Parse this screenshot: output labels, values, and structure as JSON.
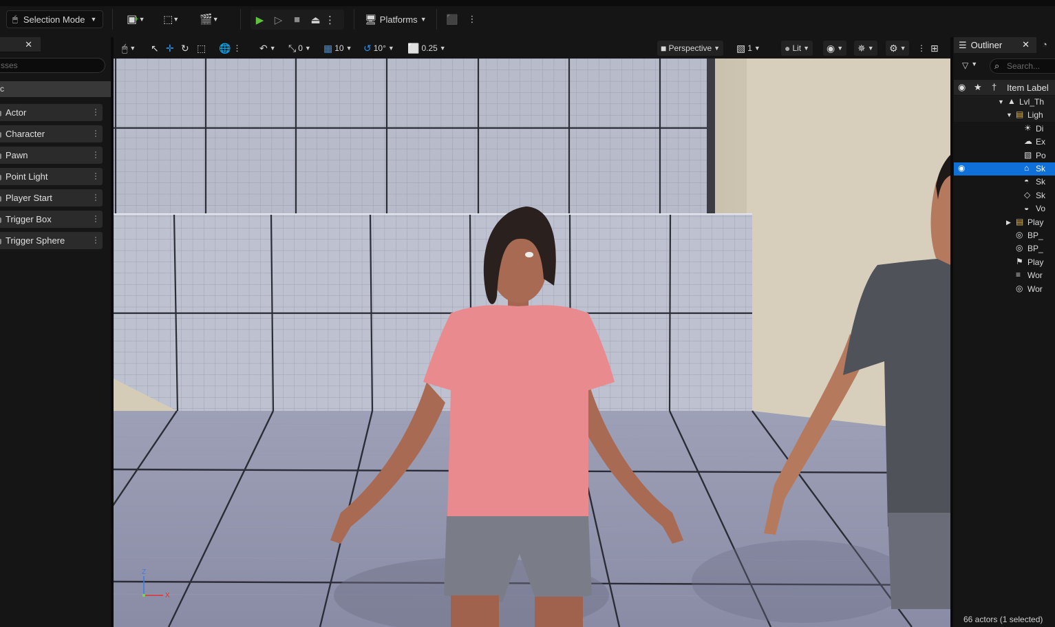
{
  "toolbar": {
    "selection_mode": "Selection Mode",
    "platforms": "Platforms"
  },
  "left_panel": {
    "search_placeholder": "sses",
    "category": "c",
    "items": [
      {
        "label": "Actor"
      },
      {
        "label": "Character"
      },
      {
        "label": "Pawn"
      },
      {
        "label": "Point Light"
      },
      {
        "label": "Player Start"
      },
      {
        "label": "Trigger Box"
      },
      {
        "label": "Trigger Sphere"
      }
    ]
  },
  "viewport_toolbar": {
    "rotation_snap": "0",
    "grid_snap": "10",
    "angle_snap": "10°",
    "scale_snap": "0.25",
    "view_mode": "Perspective",
    "camera_speed": "1",
    "lighting_mode": "Lit"
  },
  "axis": {
    "z": "Z",
    "x": "X"
  },
  "outliner": {
    "tab_title": "Outliner",
    "search_placeholder": "Search...",
    "column_label": "Item Label",
    "rows": [
      {
        "label": "Lvl_Th",
        "indent": 1,
        "icon": "level-icon",
        "expanded": true
      },
      {
        "label": "Ligh",
        "indent": 2,
        "icon": "folder-icon",
        "expanded": true
      },
      {
        "label": "Di",
        "indent": 3,
        "icon": "directional-light-icon"
      },
      {
        "label": "Ex",
        "indent": 3,
        "icon": "exponential-fog-icon"
      },
      {
        "label": "Po",
        "indent": 3,
        "icon": "post-process-icon"
      },
      {
        "label": "Sk",
        "indent": 3,
        "icon": "sky-light-icon",
        "selected": true
      },
      {
        "label": "Sk",
        "indent": 3,
        "icon": "sky-atmosphere-icon"
      },
      {
        "label": "Sk",
        "indent": 3,
        "icon": "sky-sphere-icon"
      },
      {
        "label": "Vo",
        "indent": 3,
        "icon": "volumetric-cloud-icon"
      },
      {
        "label": "Play",
        "indent": 2,
        "icon": "folder-icon",
        "expanded": false
      },
      {
        "label": "BP_",
        "indent": 2,
        "icon": "blueprint-icon"
      },
      {
        "label": "BP_",
        "indent": 2,
        "icon": "blueprint-icon"
      },
      {
        "label": "Play",
        "indent": 2,
        "icon": "player-start-icon"
      },
      {
        "label": "Wor",
        "indent": 2,
        "icon": "world-data-icon"
      },
      {
        "label": "Wor",
        "indent": 2,
        "icon": "world-settings-icon"
      }
    ],
    "footer": "66 actors (1 selected)"
  },
  "colors": {
    "accent_blue": "#0e70d8",
    "play_green": "#5fc43a",
    "shirt_pink": "#e98a8f"
  }
}
